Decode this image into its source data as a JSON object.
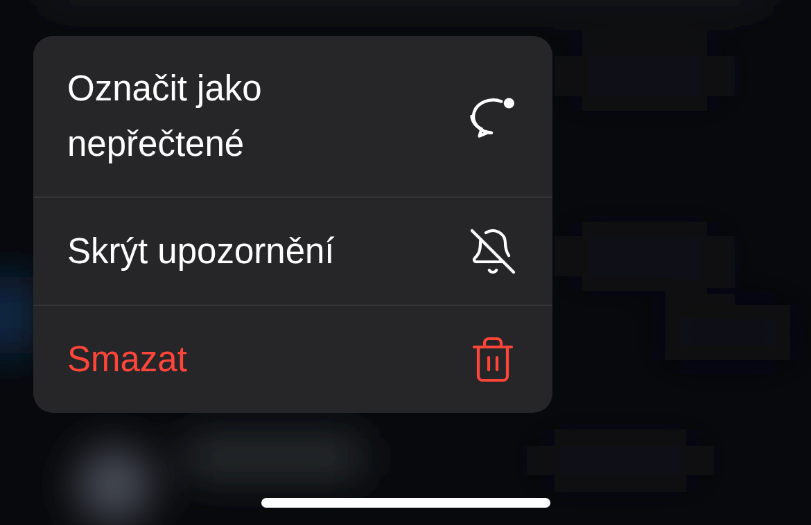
{
  "context_menu": {
    "items": [
      {
        "label": "Označit jako nepřečtené",
        "kind": "unread",
        "destructive": false
      },
      {
        "label": "Skrýt upozornění",
        "kind": "mute",
        "destructive": false
      },
      {
        "label": "Smazat",
        "kind": "delete",
        "destructive": true
      }
    ]
  }
}
